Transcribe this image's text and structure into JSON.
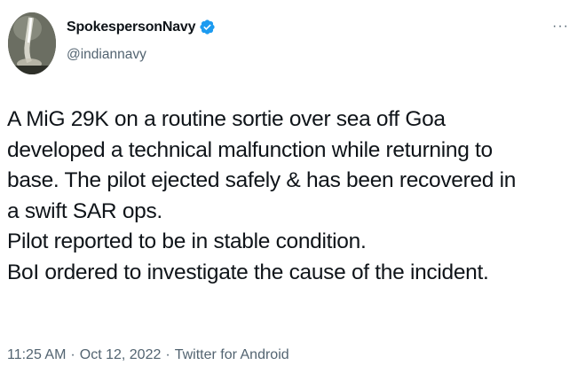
{
  "author": {
    "display_name": "SpokespersonNavy",
    "handle": "@indiannavy",
    "verified": true,
    "verified_color": "#1d9bf0",
    "avatar_icon": "missile-launch-avatar"
  },
  "menu": {
    "more_label": "···",
    "icon": "more-options-icon"
  },
  "tweet": {
    "lines": [
      "A MiG 29K on a routine sortie over sea off Goa",
      "developed a technical malfunction while returning to",
      "base. The pilot ejected safely & has been recovered in",
      "a swift SAR ops.",
      "Pilot reported to be in stable condition.",
      "BoI ordered to investigate the cause of the incident."
    ]
  },
  "meta": {
    "time": "11:25 AM",
    "separator": "·",
    "date": "Oct 12, 2022",
    "source": "Twitter for Android"
  }
}
